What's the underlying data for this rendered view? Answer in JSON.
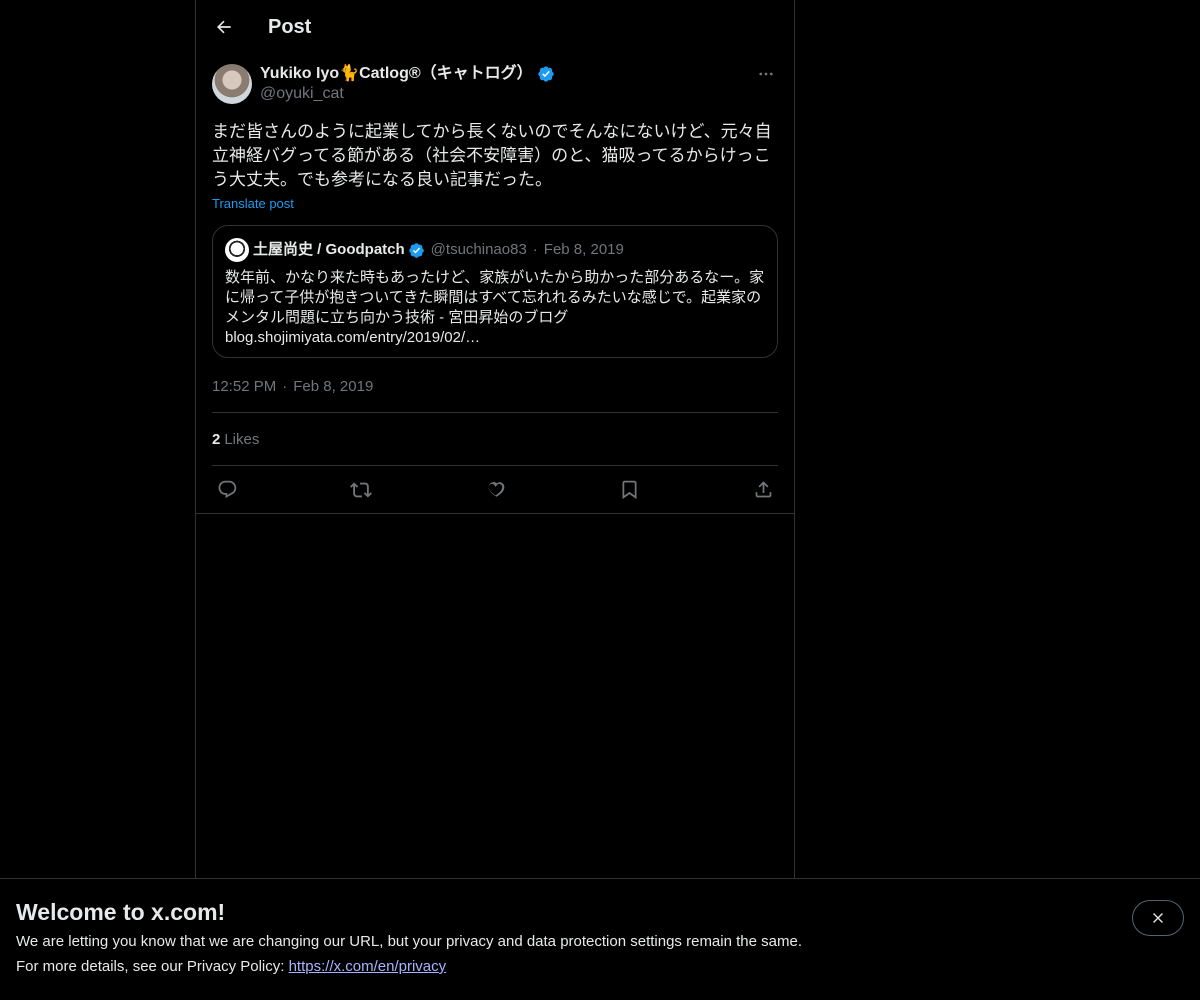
{
  "header": {
    "title": "Post"
  },
  "post": {
    "author_name": "Yukiko Iyo🐈Catlog®（キャトログ）",
    "author_handle": "@oyuki_cat",
    "text": "まだ皆さんのように起業してから長くないのでそんなにないけど、元々自立神経バグってる節がある（社会不安障害）のと、猫吸ってるからけっこう大丈夫。でも参考になる良い記事だった。",
    "translate_label": "Translate post",
    "quote": {
      "name": "土屋尚史 / Goodpatch",
      "handle": "@tsuchinao83",
      "separator": "·",
      "date": "Feb 8, 2019",
      "text": "数年前、かなり来た時もあったけど、家族がいたから助かった部分あるなー。家に帰って子供が抱きついてきた瞬間はすべて忘れれるみたいな感じで。起業家のメンタル問題に立ち向かう技術 - 宮田昇始のブログ blog.shojimiyata.com/entry/2019/02/…"
    },
    "time": "12:52 PM",
    "separator": "·",
    "date": "Feb 8, 2019",
    "likes_count": "2",
    "likes_label": "Likes"
  },
  "banner": {
    "title": "Welcome to x.com!",
    "line1": "We are letting you know that we are changing our URL, but your privacy and data protection settings remain the same.",
    "line2_prefix": "For more details, see our Privacy Policy: ",
    "link": "https://x.com/en/privacy"
  },
  "colors": {
    "background": "#000000",
    "text": "#e7e9ea",
    "muted": "#71767b",
    "accent": "#1d9bf0",
    "border": "#2f3336",
    "link": "#a8b3ff"
  },
  "icons": [
    "back-arrow-icon",
    "verified-badge-icon",
    "more-icon",
    "reply-icon",
    "repost-icon",
    "like-icon",
    "bookmark-icon",
    "share-icon",
    "close-icon"
  ]
}
